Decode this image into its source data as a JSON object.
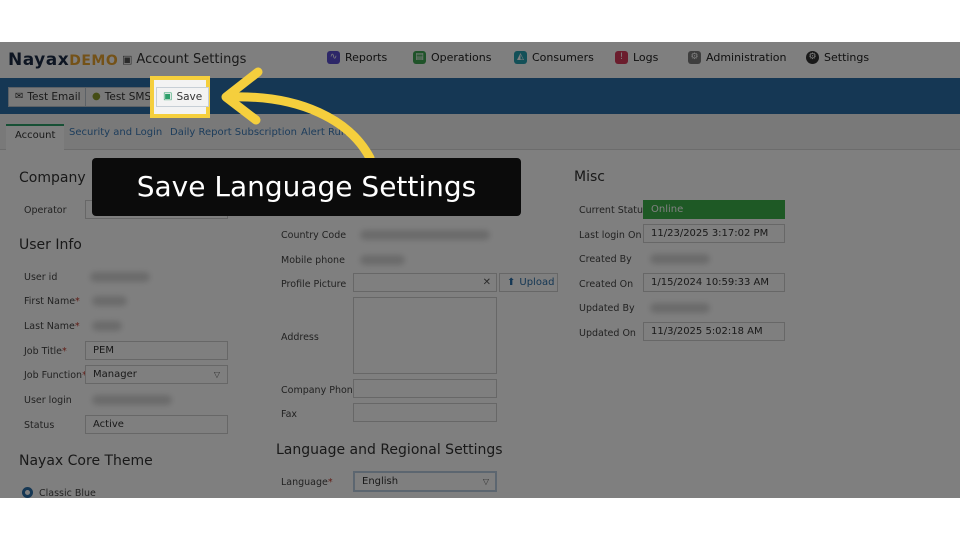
{
  "header": {
    "logo_main": "Nayax",
    "logo_demo": "DEMO",
    "page_title": "Account Settings",
    "nav": [
      {
        "label": "Reports",
        "icon": "chart-icon",
        "color": "#5b4fd1"
      },
      {
        "label": "Operations",
        "icon": "operations-icon",
        "color": "#3ea653"
      },
      {
        "label": "Consumers",
        "icon": "consumers-icon",
        "color": "#26a0b0"
      },
      {
        "label": "Logs",
        "icon": "logs-icon",
        "color": "#d63a5a"
      },
      {
        "label": "Administration",
        "icon": "administration-icon",
        "color": "#7d7d7d"
      },
      {
        "label": "Settings",
        "icon": "settings-icon",
        "color": "#333333"
      }
    ]
  },
  "toolbar": {
    "test_email": "Test Email",
    "test_sms": "Test SMS",
    "save": "Save"
  },
  "tabs": [
    "Account",
    "Security and Login",
    "Daily Report Subscription",
    "Alert Rules"
  ],
  "company": {
    "heading": "Company",
    "operator_label": "Operator"
  },
  "user_info": {
    "heading": "User Info",
    "user_id_label": "User id",
    "first_name_label": "First Name",
    "last_name_label": "Last Name",
    "job_title_label": "Job Title",
    "job_title_value": "PEM",
    "job_function_label": "Job Function",
    "job_function_value": "Manager",
    "user_login_label": "User login",
    "status_label": "Status",
    "status_value": "Active"
  },
  "theme": {
    "heading": "Nayax Core Theme",
    "option": "Classic Blue"
  },
  "contact": {
    "country_code_label": "Country Code",
    "mobile_phone_label": "Mobile phone",
    "profile_picture_label": "Profile Picture",
    "clear_symbol": "✕",
    "upload_label": "Upload",
    "address_label": "Address",
    "company_phone_label": "Company Phone",
    "fax_label": "Fax"
  },
  "language": {
    "heading": "Language and Regional Settings",
    "language_label": "Language",
    "language_value": "English"
  },
  "misc": {
    "heading": "Misc",
    "current_status_label": "Current Status",
    "current_status_value": "Online",
    "last_login_label": "Last login On",
    "last_login_value": "11/23/2025 3:17:02 PM",
    "created_by_label": "Created By",
    "created_on_label": "Created On",
    "created_on_value": "1/15/2024 10:59:33 AM",
    "updated_by_label": "Updated By",
    "updated_on_label": "Updated On",
    "updated_on_value": "11/3/2025 5:02:18 AM"
  },
  "tooltip": {
    "text": "Save Language Settings"
  },
  "colors": {
    "accent_blue": "#2b6ea8",
    "highlight_yellow": "#f5cf3d",
    "online_green": "#3cb34a"
  }
}
